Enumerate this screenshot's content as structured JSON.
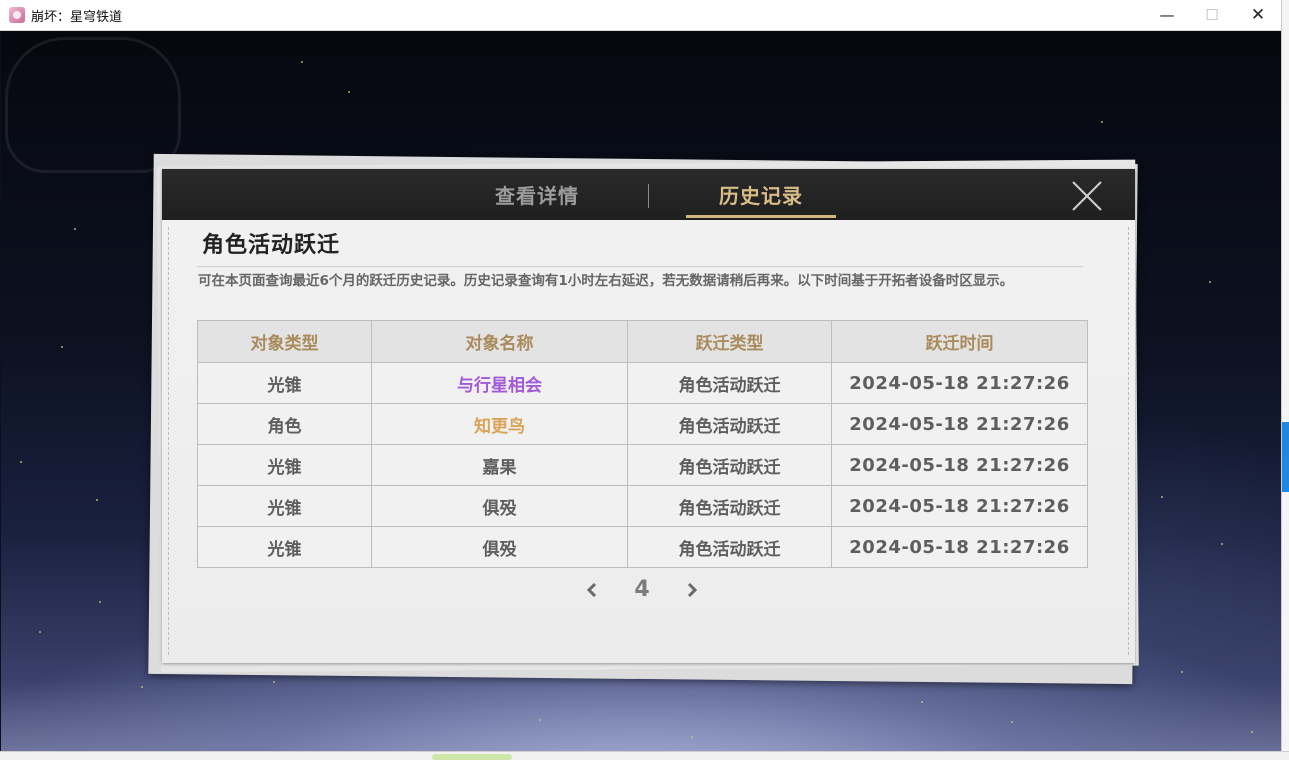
{
  "window": {
    "title": "崩坏：星穹铁道",
    "minimize": "—",
    "maximize": "☐",
    "close": "✕"
  },
  "tabs": {
    "details": "查看详情",
    "history": "历史记录",
    "active": "history"
  },
  "section": {
    "title": "角色活动跃迁",
    "description": "可在本页面查询最近6个月的跃迁历史记录。历史记录查询有1小时左右延迟，若无数据请稍后再来。以下时间基于开拓者设备时区显示。"
  },
  "table": {
    "headers": [
      "对象类型",
      "对象名称",
      "跃迁类型",
      "跃迁时间"
    ],
    "rows": [
      {
        "type": "光锥",
        "name": "与行星相会",
        "name_color": "#a259d9",
        "warp": "角色活动跃迁",
        "time": "2024-05-18 21:27:26"
      },
      {
        "type": "角色",
        "name": "知更鸟",
        "name_color": "#d9a45a",
        "warp": "角色活动跃迁",
        "time": "2024-05-18 21:27:26"
      },
      {
        "type": "光锥",
        "name": "嘉果",
        "name_color": "#5e5e5e",
        "warp": "角色活动跃迁",
        "time": "2024-05-18 21:27:26"
      },
      {
        "type": "光锥",
        "name": "俱殁",
        "name_color": "#5e5e5e",
        "warp": "角色活动跃迁",
        "time": "2024-05-18 21:27:26"
      },
      {
        "type": "光锥",
        "name": "俱殁",
        "name_color": "#5e5e5e",
        "warp": "角色活动跃迁",
        "time": "2024-05-18 21:27:26"
      }
    ]
  },
  "pagination": {
    "current_page": "4"
  },
  "icons": {
    "close": "close-icon",
    "prev": "chevron-left-icon",
    "next": "chevron-right-icon"
  },
  "colors": {
    "header_text": "#a98b5c",
    "active_tab": "#d9bc86",
    "tab_bar": "#222222"
  }
}
